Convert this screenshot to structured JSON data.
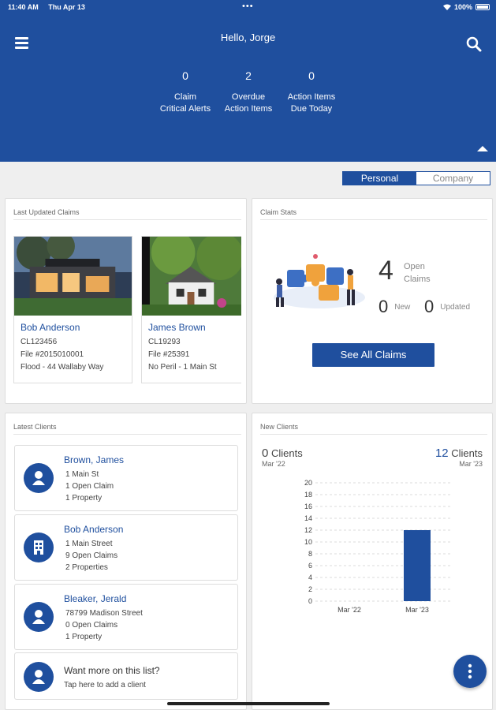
{
  "status_bar": {
    "time": "11:40 AM",
    "date": "Thu Apr 13",
    "battery": "100%"
  },
  "header": {
    "greeting": "Hello, Jorge",
    "stats": [
      {
        "value": "0",
        "label_1": "Claim",
        "label_2": "Critical Alerts"
      },
      {
        "value": "2",
        "label_1": "Overdue",
        "label_2": "Action Items"
      },
      {
        "value": "0",
        "label_1": "Action Items",
        "label_2": "Due Today"
      }
    ]
  },
  "toggle": {
    "personal": "Personal",
    "company": "Company",
    "selected": "Personal"
  },
  "last_updated_claims": {
    "title": "Last Updated Claims",
    "cards": [
      {
        "name": "Bob Anderson",
        "claim_id": "CL123456",
        "file": "File #2015010001",
        "detail": "Flood - 44 Wallaby Way"
      },
      {
        "name": "James Brown",
        "claim_id": "CL19293",
        "file": "File #25391",
        "detail": "No Peril - 1 Main St"
      }
    ]
  },
  "claim_stats": {
    "title": "Claim Stats",
    "open_count": "4",
    "open_label_1": "Open",
    "open_label_2": "Claims",
    "new_count": "0",
    "new_label": "New",
    "updated_count": "0",
    "updated_label": "Updated",
    "see_all_label": "See All Claims"
  },
  "latest_clients": {
    "title": "Latest Clients",
    "clients": [
      {
        "name": "Brown, James",
        "line_1": "1 Main St",
        "line_2": "1 Open Claim",
        "line_3": "1 Property",
        "icon": "person-icon"
      },
      {
        "name": "Bob Anderson",
        "line_1": "1 Main Street",
        "line_2": "9 Open Claims",
        "line_3": "2 Properties",
        "icon": "building-icon"
      },
      {
        "name": "Bleaker, Jerald",
        "line_1": "78799 Madison Street",
        "line_2": "0 Open Claims",
        "line_3": "1 Property",
        "icon": "person-icon"
      }
    ],
    "add_prompt": {
      "title": "Want more on this list?",
      "subtitle": "Tap here to add a client"
    }
  },
  "new_clients": {
    "title": "New Clients",
    "left": {
      "value": "0",
      "unit": "Clients",
      "date": "Mar '22"
    },
    "right": {
      "value": "12",
      "unit": "Clients",
      "date": "Mar '23"
    }
  },
  "chart_data": {
    "type": "bar",
    "categories": [
      "Mar '22",
      "Mar '23"
    ],
    "values": [
      0,
      12
    ],
    "ylim": [
      0,
      20
    ],
    "yticks": [
      0,
      2,
      4,
      6,
      8,
      10,
      12,
      14,
      16,
      18,
      20
    ],
    "grid": true,
    "bar_color": "#1f4f9e"
  },
  "colors": {
    "brand": "#1f4f9e"
  }
}
